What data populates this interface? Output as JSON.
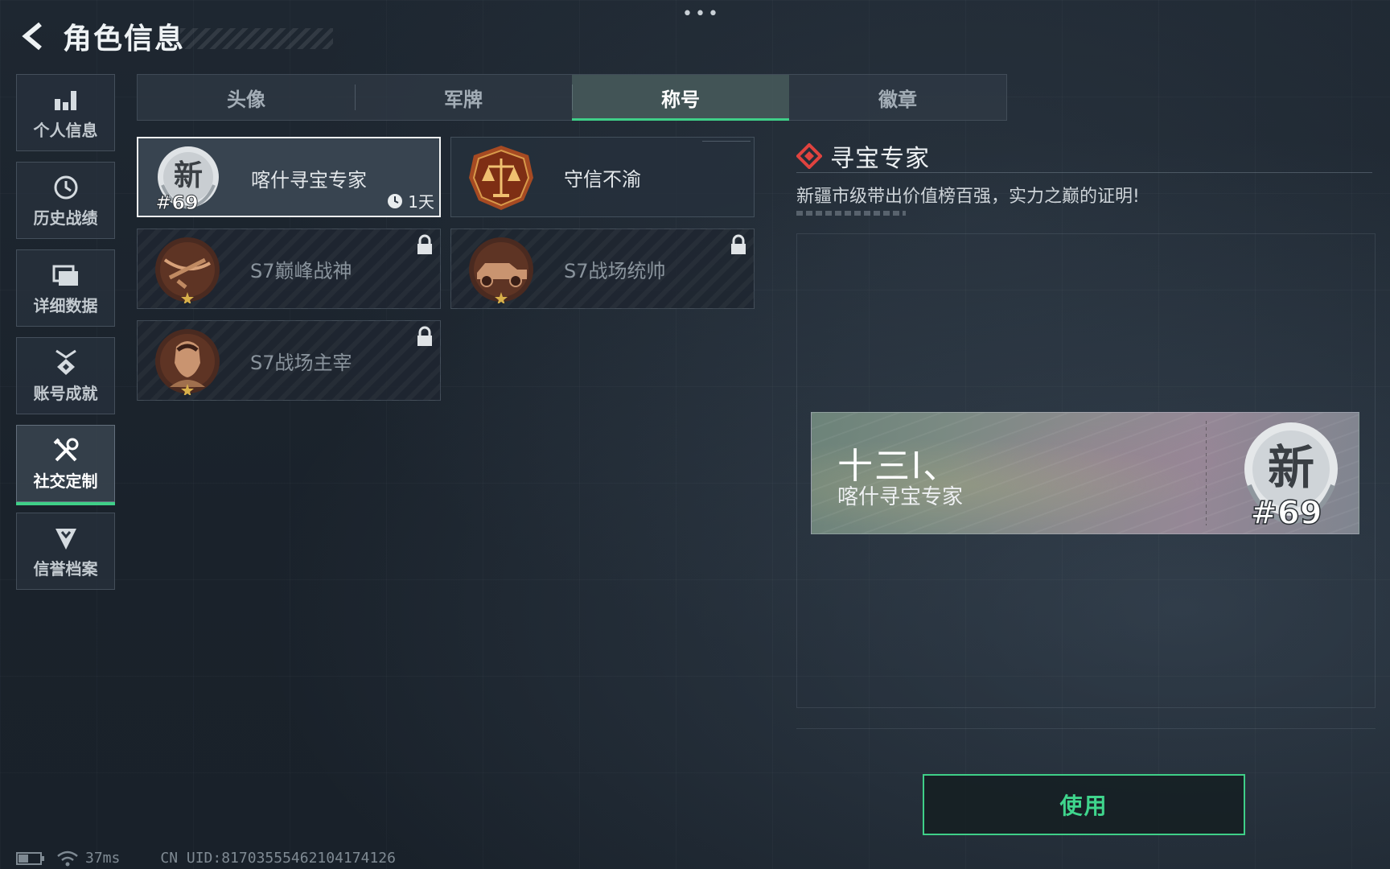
{
  "header": {
    "title": "角色信息"
  },
  "sidebar": {
    "items": [
      {
        "label": "个人信息",
        "icon": "bar-chart-icon",
        "active": false
      },
      {
        "label": "历史战绩",
        "icon": "history-icon",
        "active": false
      },
      {
        "label": "详细数据",
        "icon": "folder-icon",
        "active": false
      },
      {
        "label": "账号成就",
        "icon": "medal-icon",
        "active": false
      },
      {
        "label": "社交定制",
        "icon": "tools-icon",
        "active": true
      },
      {
        "label": "信誉档案",
        "icon": "shield-icon",
        "active": false
      }
    ]
  },
  "tabs": [
    {
      "label": "头像",
      "active": false
    },
    {
      "label": "军牌",
      "active": false
    },
    {
      "label": "称号",
      "active": true
    },
    {
      "label": "徽章",
      "active": false
    }
  ],
  "titles": [
    {
      "label": "喀什寻宝专家",
      "emblem_text": "新",
      "rank": "#69",
      "timer": "1天",
      "selected": true,
      "locked": false
    },
    {
      "label": "守信不渝",
      "emblem": "scales-icon",
      "selected": false,
      "locked": false
    },
    {
      "label": "S7巅峰战神",
      "emblem": "crossbow-icon",
      "selected": false,
      "locked": true
    },
    {
      "label": "S7战场统帅",
      "emblem": "vehicle-icon",
      "selected": false,
      "locked": true
    },
    {
      "label": "S7战场主宰",
      "emblem": "warrior-icon",
      "selected": false,
      "locked": true
    }
  ],
  "detail": {
    "title": "寻宝专家",
    "description": "新疆市级带出价值榜百强，实力之巅的证明!"
  },
  "preview": {
    "player_name": "十三l、",
    "title": "喀什寻宝专家",
    "emblem_text": "新",
    "rank": "#69"
  },
  "use_button": "使用",
  "status": {
    "ping": "37ms",
    "uid": "CN UID:817035554621041741​26"
  },
  "colors": {
    "accent": "#3fcf88",
    "detail_marker": "#e0433f"
  }
}
